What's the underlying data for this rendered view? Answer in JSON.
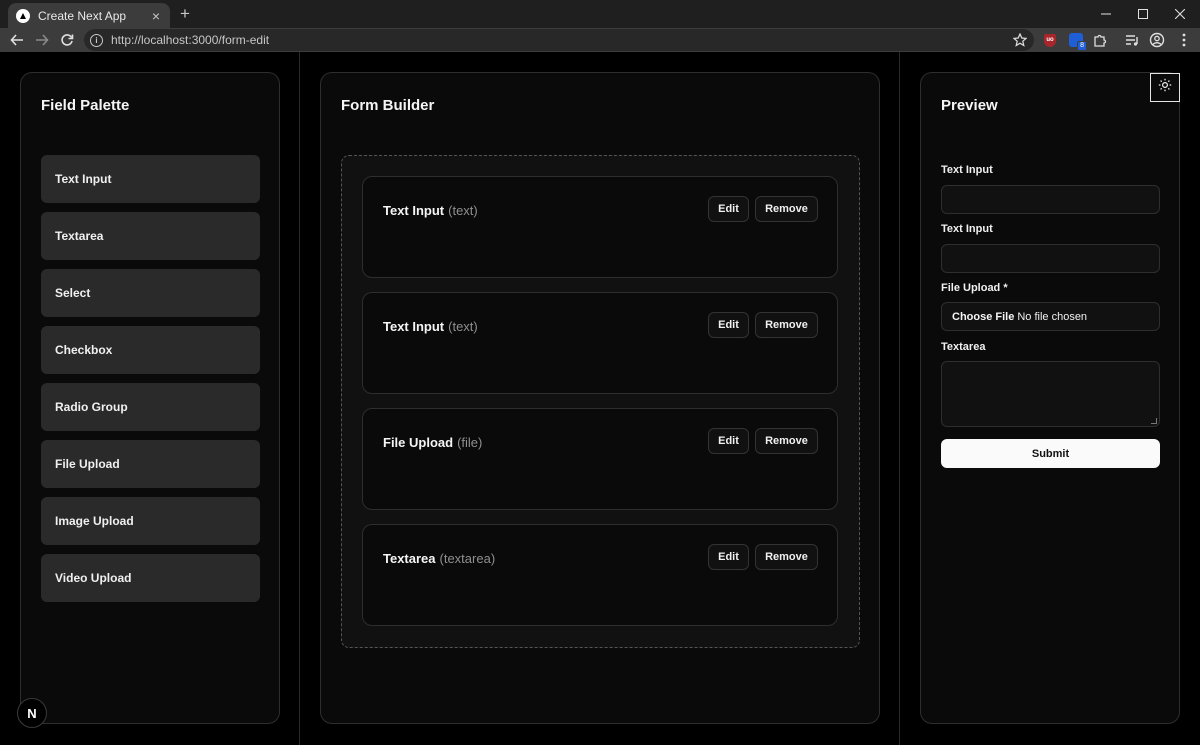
{
  "browser": {
    "tab_title": "Create Next App",
    "new_tab_symbol": "+",
    "url": "http://localhost:3000/form-edit",
    "extension_badge": "8"
  },
  "palette": {
    "title": "Field Palette",
    "items": [
      {
        "label": "Text Input"
      },
      {
        "label": "Textarea"
      },
      {
        "label": "Select"
      },
      {
        "label": "Checkbox"
      },
      {
        "label": "Radio Group"
      },
      {
        "label": "File Upload"
      },
      {
        "label": "Image Upload"
      },
      {
        "label": "Video Upload"
      }
    ]
  },
  "builder": {
    "title": "Form Builder",
    "edit_label": "Edit",
    "remove_label": "Remove",
    "fields": [
      {
        "label": "Text Input",
        "type": "(text)"
      },
      {
        "label": "Text Input",
        "type": "(text)"
      },
      {
        "label": "File Upload",
        "type": "(file)"
      },
      {
        "label": "Textarea",
        "type": "(textarea)"
      }
    ]
  },
  "preview": {
    "title": "Preview",
    "text_input_1_label": "Text Input",
    "text_input_2_label": "Text Input",
    "file_upload_label": "File Upload *",
    "file_button": "Choose File",
    "file_status": "No file chosen",
    "textarea_label": "Textarea",
    "submit_label": "Submit"
  },
  "next_badge": "N",
  "colors": {
    "background": "#000000",
    "panel": "#0a0a0a",
    "palette_item": "#2a2a2a",
    "submit_bg": "#fafafa"
  }
}
